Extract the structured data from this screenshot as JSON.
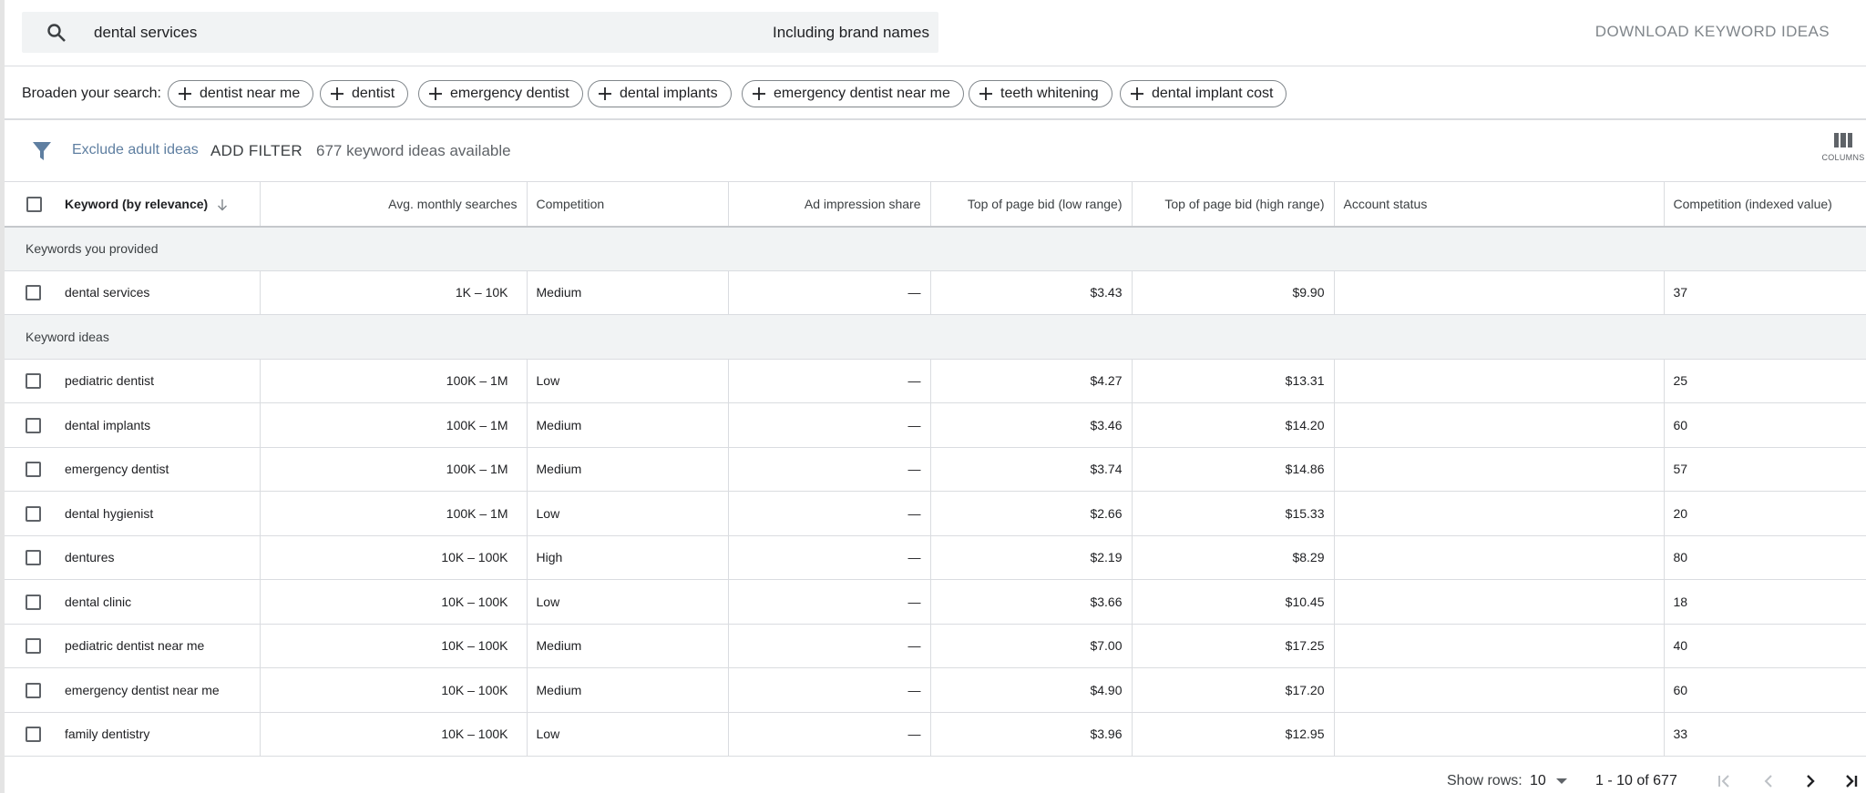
{
  "search": {
    "query": "dental services",
    "brand_names": "Including brand names",
    "download_label": "DOWNLOAD KEYWORD IDEAS"
  },
  "broaden": {
    "label": "Broaden your search:",
    "chips": [
      "dentist near me",
      "dentist",
      "emergency dentist",
      "dental implants",
      "emergency dentist near me",
      "teeth whitening",
      "dental implant cost"
    ]
  },
  "filters": {
    "exclude_adult": "Exclude adult ideas",
    "add_filter": "ADD FILTER",
    "available": "677 keyword ideas available",
    "columns_label": "COLUMNS"
  },
  "table": {
    "headers": {
      "keyword": "Keyword (by relevance)",
      "avg": "Avg. monthly searches",
      "competition": "Competition",
      "ad_share": "Ad impression share",
      "bid_low": "Top of page bid (low range)",
      "bid_high": "Top of page bid (high range)",
      "account": "Account status",
      "comp_index": "Competition (indexed value)"
    },
    "sections": {
      "provided": "Keywords you provided",
      "ideas": "Keyword ideas"
    },
    "provided_rows": [
      {
        "keyword": "dental services",
        "avg": "1K – 10K",
        "competition": "Medium",
        "ad_share": "—",
        "bid_low": "$3.43",
        "bid_high": "$9.90",
        "account": "",
        "comp_index": "37"
      }
    ],
    "idea_rows": [
      {
        "keyword": "pediatric dentist",
        "avg": "100K – 1M",
        "competition": "Low",
        "ad_share": "—",
        "bid_low": "$4.27",
        "bid_high": "$13.31",
        "account": "",
        "comp_index": "25"
      },
      {
        "keyword": "dental implants",
        "avg": "100K – 1M",
        "competition": "Medium",
        "ad_share": "—",
        "bid_low": "$3.46",
        "bid_high": "$14.20",
        "account": "",
        "comp_index": "60"
      },
      {
        "keyword": "emergency dentist",
        "avg": "100K – 1M",
        "competition": "Medium",
        "ad_share": "—",
        "bid_low": "$3.74",
        "bid_high": "$14.86",
        "account": "",
        "comp_index": "57"
      },
      {
        "keyword": "dental hygienist",
        "avg": "100K – 1M",
        "competition": "Low",
        "ad_share": "—",
        "bid_low": "$2.66",
        "bid_high": "$15.33",
        "account": "",
        "comp_index": "20"
      },
      {
        "keyword": "dentures",
        "avg": "10K – 100K",
        "competition": "High",
        "ad_share": "—",
        "bid_low": "$2.19",
        "bid_high": "$8.29",
        "account": "",
        "comp_index": "80"
      },
      {
        "keyword": "dental clinic",
        "avg": "10K – 100K",
        "competition": "Low",
        "ad_share": "—",
        "bid_low": "$3.66",
        "bid_high": "$10.45",
        "account": "",
        "comp_index": "18"
      },
      {
        "keyword": "pediatric dentist near me",
        "avg": "10K – 100K",
        "competition": "Medium",
        "ad_share": "—",
        "bid_low": "$7.00",
        "bid_high": "$17.25",
        "account": "",
        "comp_index": "40"
      },
      {
        "keyword": "emergency dentist near me",
        "avg": "10K – 100K",
        "competition": "Medium",
        "ad_share": "—",
        "bid_low": "$4.90",
        "bid_high": "$17.20",
        "account": "",
        "comp_index": "60"
      },
      {
        "keyword": "family dentistry",
        "avg": "10K – 100K",
        "competition": "Low",
        "ad_share": "—",
        "bid_low": "$3.96",
        "bid_high": "$12.95",
        "account": "",
        "comp_index": "33"
      }
    ]
  },
  "footer": {
    "show_rows_label": "Show rows:",
    "rows_value": "10",
    "range": "1 - 10 of 677"
  },
  "icons": {
    "search": "search-icon",
    "add": "plus-icon",
    "filter": "filter-icon",
    "columns": "columns-icon",
    "sort": "arrow-down-icon",
    "first": "first-page-icon",
    "prev": "chevron-left-icon",
    "next": "chevron-right-icon",
    "last": "last-page-icon"
  },
  "colors": {
    "link_muted": "#5f7fa1",
    "section_bg": "#f1f3f4",
    "border": "#dadce0"
  }
}
